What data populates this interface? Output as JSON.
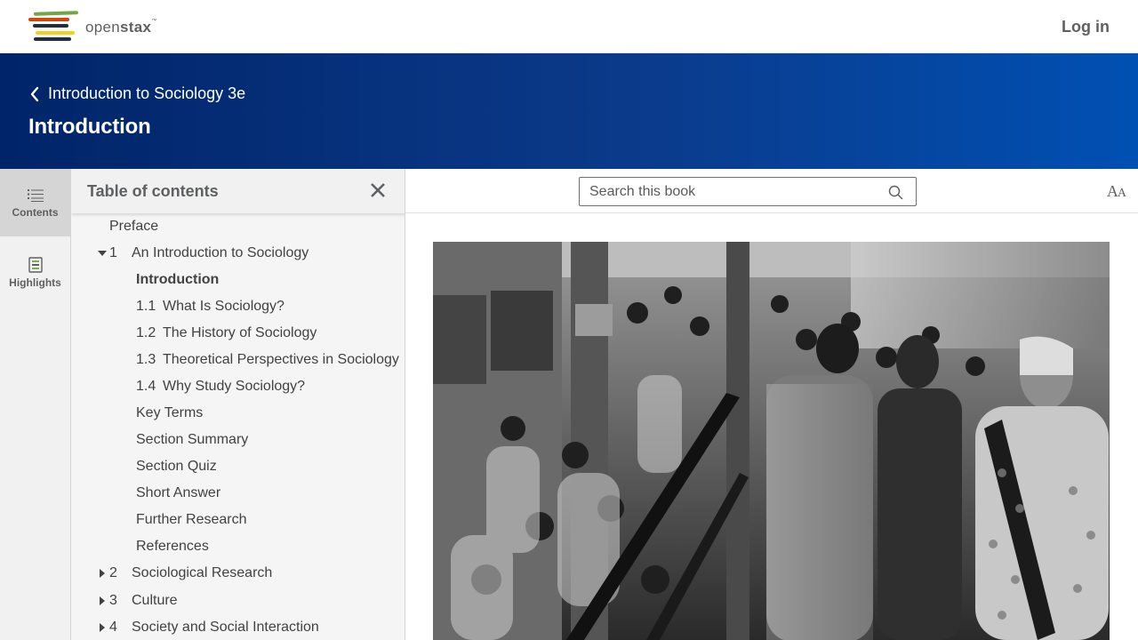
{
  "header": {
    "logo_text_light": "open",
    "logo_text_bold": "stax",
    "logo_tm": "™",
    "login_label": "Log in"
  },
  "banner": {
    "book_title": "Introduction to Sociology 3e",
    "chapter_title": "Introduction"
  },
  "rail": {
    "contents_label": "Contents",
    "highlights_label": "Highlights"
  },
  "toc": {
    "title": "Table of contents",
    "items": [
      {
        "num": "",
        "label": "Preface",
        "bold": false
      },
      {
        "num": "1",
        "label": "An Introduction to Sociology",
        "bold": false,
        "expanded": true
      },
      {
        "num": "",
        "label": "Introduction",
        "bold": true
      },
      {
        "num": "1.1",
        "label": "What Is Sociology?",
        "bold": false
      },
      {
        "num": "1.2",
        "label": "The History of Sociology",
        "bold": false
      },
      {
        "num": "1.3",
        "label": "Theoretical Perspectives in Sociology",
        "bold": false
      },
      {
        "num": "1.4",
        "label": "Why Study Sociology?",
        "bold": false
      },
      {
        "num": "",
        "label": "Key Terms",
        "bold": false
      },
      {
        "num": "",
        "label": "Section Summary",
        "bold": false
      },
      {
        "num": "",
        "label": "Section Quiz",
        "bold": false
      },
      {
        "num": "",
        "label": "Short Answer",
        "bold": false
      },
      {
        "num": "",
        "label": "Further Research",
        "bold": false
      },
      {
        "num": "",
        "label": "References",
        "bold": false
      },
      {
        "num": "2",
        "label": "Sociological Research",
        "bold": false,
        "expanded": false
      },
      {
        "num": "3",
        "label": "Culture",
        "bold": false,
        "expanded": false
      },
      {
        "num": "4",
        "label": "Society and Social Interaction",
        "bold": false,
        "expanded": false
      }
    ]
  },
  "toolbar": {
    "search_placeholder": "Search this book",
    "font_size_label_big": "A",
    "font_size_label_small": "A"
  },
  "colors": {
    "banner_start": "#002468",
    "banner_end": "#0050b3",
    "logo_bars": [
      "#6fa744",
      "#d4450c",
      "#232e3a",
      "#f4d019",
      "#232e3a"
    ]
  }
}
